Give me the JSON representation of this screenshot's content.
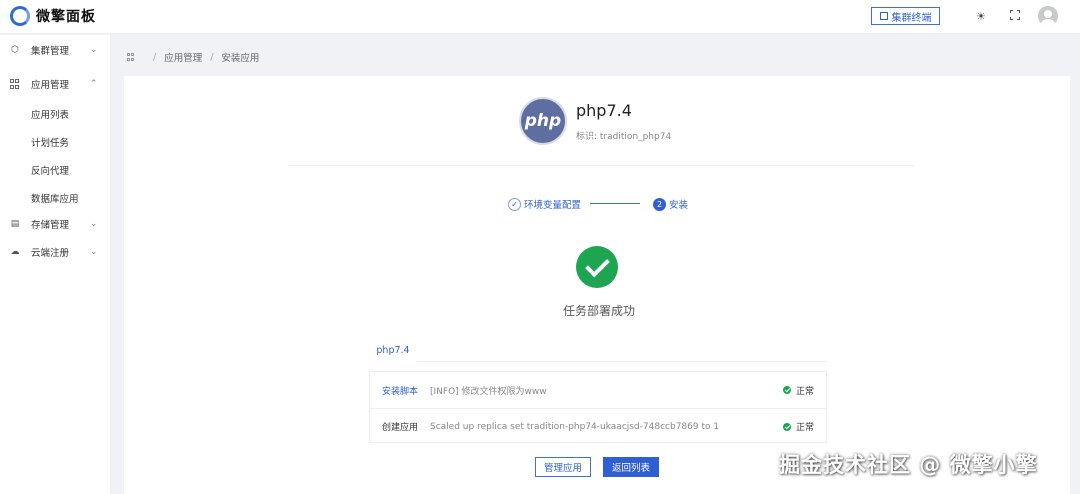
{
  "header": {
    "brand": "微擎面板",
    "cluster_terminal": "集群终端"
  },
  "sidebar": {
    "items": [
      {
        "label": "集群管理",
        "icon": "cube-icon",
        "expanded": false
      },
      {
        "label": "应用管理",
        "icon": "grid-icon",
        "expanded": true
      },
      {
        "label": "存储管理",
        "icon": "storage-icon",
        "expanded": false
      },
      {
        "label": "云端注册",
        "icon": "cloud-icon",
        "expanded": false
      }
    ],
    "sub_items": [
      "应用列表",
      "计划任务",
      "反向代理",
      "数据库应用"
    ]
  },
  "breadcrumb": {
    "level1": "应用管理",
    "level2": "安装应用"
  },
  "app": {
    "logo_text": "php",
    "name": "php7.4",
    "id_label": "标识: tradition_php74"
  },
  "steps": [
    {
      "label": "环境变量配置",
      "status": "done",
      "marker": "✓"
    },
    {
      "label": "安装",
      "status": "current",
      "marker": "2"
    }
  ],
  "result": {
    "text": "任务部署成功"
  },
  "tabs": {
    "active": "php7.4"
  },
  "logs": [
    {
      "name": "安装脚本",
      "message": "[INFO] 修改文件权限为www",
      "status": "正常",
      "name_color": "#2f5fd0"
    },
    {
      "name": "创建应用",
      "message": "Scaled up replica set tradition-php74-ukaacjsd-748ccb7869 to 1",
      "status": "正常",
      "name_color": "#333333"
    }
  ],
  "actions": {
    "manage": "管理应用",
    "back": "返回列表"
  },
  "watermark": "掘金技术社区 @ 微擎小擎",
  "colors": {
    "primary": "#2f5fd0",
    "success": "#1ea552"
  }
}
